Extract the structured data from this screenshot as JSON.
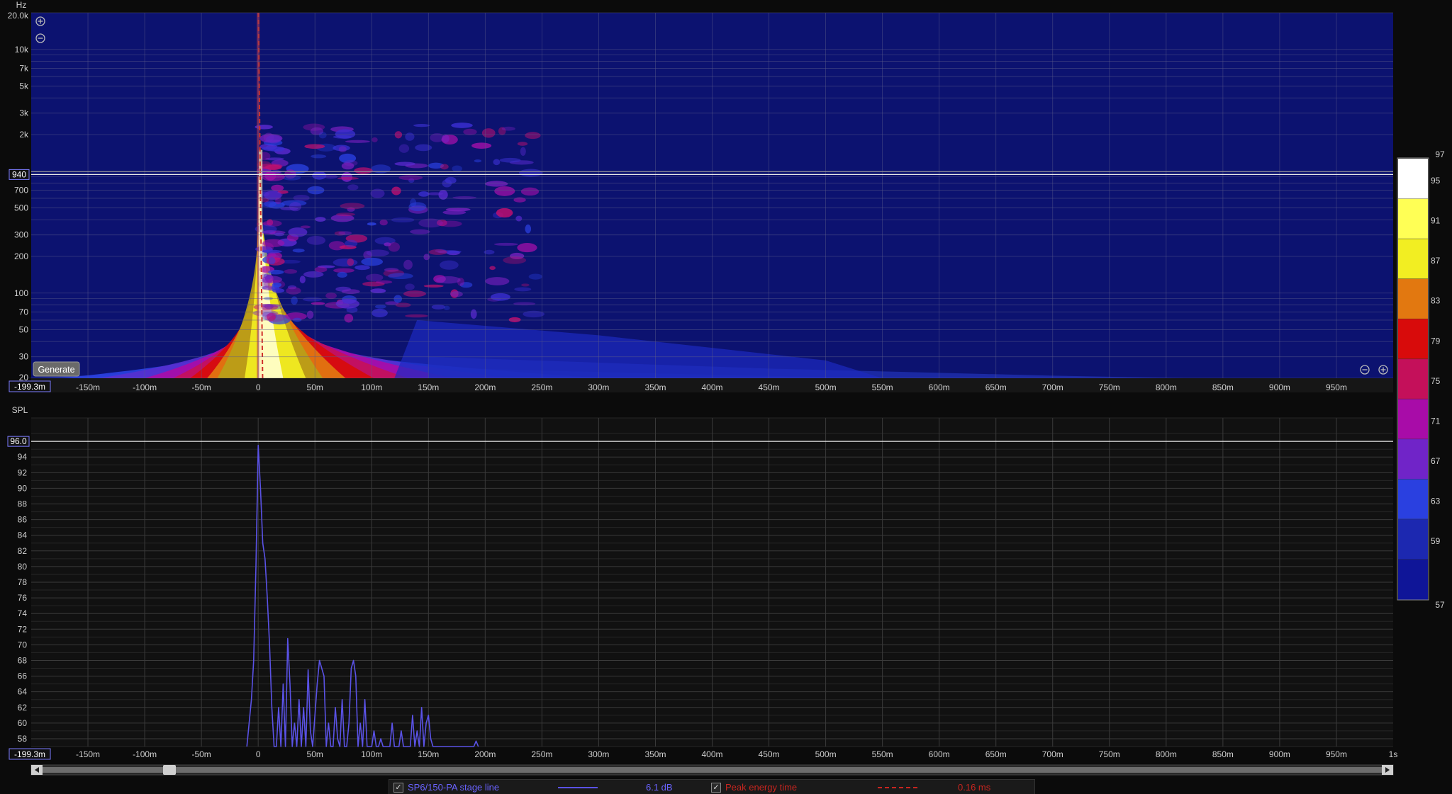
{
  "colors": {
    "bg": "#0b0b0b",
    "panel": "#111111",
    "spectro_bg": "#0c1270",
    "grid": "#3a3a3a",
    "trace": "#5a52e6",
    "peak_line": "#d0302a",
    "cursor": "#e8e8e8",
    "label_box_border": "#7b7bff"
  },
  "spectrogram": {
    "unit_label": "Hz",
    "y_ticks": [
      {
        "v": 20000,
        "label": "20.0k"
      },
      {
        "v": 10000,
        "label": "10k"
      },
      {
        "v": 7000,
        "label": "7k"
      },
      {
        "v": 5000,
        "label": "5k"
      },
      {
        "v": 3000,
        "label": "3k"
      },
      {
        "v": 2000,
        "label": "2k"
      },
      {
        "v": 700,
        "label": "700"
      },
      {
        "v": 500,
        "label": "500"
      },
      {
        "v": 300,
        "label": "300"
      },
      {
        "v": 200,
        "label": "200"
      },
      {
        "v": 100,
        "label": "100"
      },
      {
        "v": 70,
        "label": "70"
      },
      {
        "v": 50,
        "label": "50"
      },
      {
        "v": 30,
        "label": "30"
      },
      {
        "v": 20,
        "label": "20"
      }
    ],
    "cursor_freq": 940,
    "cursor_label": "940",
    "x_cursor_label": "-199.3m",
    "generate_button": "Generate"
  },
  "colorbar": {
    "top_label": "97",
    "bottom_label": "57",
    "ticks": [
      "95",
      "91",
      "87",
      "83",
      "79",
      "75",
      "71",
      "67",
      "63",
      "59"
    ],
    "bands": [
      "#ffffff",
      "#ffff55",
      "#f2ee22",
      "#e27810",
      "#d80b0b",
      "#c4105a",
      "#a80ca8",
      "#7024c8",
      "#2a40e0",
      "#1c28b0",
      "#0f1598"
    ]
  },
  "x_axis": {
    "min": -0.2,
    "max": 1.0,
    "ticks": [
      {
        "v": -0.15,
        "label": "-150m"
      },
      {
        "v": -0.1,
        "label": "-100m"
      },
      {
        "v": -0.05,
        "label": "-50m"
      },
      {
        "v": 0,
        "label": "0"
      },
      {
        "v": 0.05,
        "label": "50m"
      },
      {
        "v": 0.1,
        "label": "100m"
      },
      {
        "v": 0.15,
        "label": "150m"
      },
      {
        "v": 0.2,
        "label": "200m"
      },
      {
        "v": 0.25,
        "label": "250m"
      },
      {
        "v": 0.3,
        "label": "300m"
      },
      {
        "v": 0.35,
        "label": "350m"
      },
      {
        "v": 0.4,
        "label": "400m"
      },
      {
        "v": 0.45,
        "label": "450m"
      },
      {
        "v": 0.5,
        "label": "500m"
      },
      {
        "v": 0.55,
        "label": "550m"
      },
      {
        "v": 0.6,
        "label": "600m"
      },
      {
        "v": 0.65,
        "label": "650m"
      },
      {
        "v": 0.7,
        "label": "700m"
      },
      {
        "v": 0.75,
        "label": "750m"
      },
      {
        "v": 0.8,
        "label": "800m"
      },
      {
        "v": 0.85,
        "label": "850m"
      },
      {
        "v": 0.9,
        "label": "900m"
      },
      {
        "v": 0.95,
        "label": "950m"
      }
    ],
    "end_label_bottom": "1s"
  },
  "spl": {
    "label": "SPL",
    "cursor_label": "96.0",
    "x_cursor_label": "-199.3m",
    "ylim": [
      57,
      99
    ]
  },
  "legend": {
    "series1_name": "SP6/150-PA stage line",
    "series1_value": "6.1 dB",
    "series2_name": "Peak energy time",
    "series2_value": "0.16 ms"
  },
  "chart_data": [
    {
      "type": "heatmap",
      "title": "",
      "xlabel": "",
      "ylabel": "Hz",
      "x_range": [
        -0.2,
        1.0
      ],
      "y_range": [
        20,
        20000
      ],
      "y_scale": "log",
      "z_range": [
        57,
        97
      ],
      "peak_energy_time_ms": 0.16,
      "cursor": {
        "freq_hz": 940,
        "time": -0.1993
      }
    },
    {
      "type": "line",
      "title": "",
      "xlabel": "",
      "ylabel": "SPL",
      "xlim": [
        -0.2,
        1.0
      ],
      "ylim": [
        57,
        99
      ],
      "y_ticks": [
        58,
        60,
        62,
        64,
        66,
        68,
        70,
        72,
        74,
        76,
        78,
        80,
        82,
        84,
        86,
        88,
        90,
        92,
        94
      ],
      "series": [
        {
          "name": "SP6/150-PA stage line",
          "x": [
            -0.01,
            -0.006,
            -0.004,
            -0.002,
            0.0,
            0.002,
            0.004,
            0.006,
            0.008,
            0.01,
            0.012,
            0.014,
            0.016,
            0.018,
            0.02,
            0.022,
            0.024,
            0.026,
            0.028,
            0.03,
            0.032,
            0.034,
            0.036,
            0.038,
            0.04,
            0.042,
            0.044,
            0.046,
            0.048,
            0.05,
            0.052,
            0.054,
            0.056,
            0.058,
            0.06,
            0.062,
            0.064,
            0.066,
            0.068,
            0.07,
            0.072,
            0.074,
            0.076,
            0.078,
            0.08,
            0.082,
            0.084,
            0.086,
            0.088,
            0.09,
            0.092,
            0.094,
            0.096,
            0.098,
            0.1,
            0.102,
            0.104,
            0.106,
            0.108,
            0.11,
            0.112,
            0.114,
            0.116,
            0.118,
            0.12,
            0.122,
            0.124,
            0.126,
            0.128,
            0.13,
            0.132,
            0.134,
            0.136,
            0.138,
            0.14,
            0.142,
            0.144,
            0.146,
            0.148,
            0.15,
            0.152,
            0.154,
            0.156,
            0.19,
            0.192,
            0.194
          ],
          "values": [
            57,
            63,
            68,
            80,
            95.5,
            90,
            83,
            81,
            76,
            70,
            62,
            57,
            57,
            62,
            57,
            65,
            57,
            70.8,
            65,
            57,
            60,
            57,
            63,
            57,
            62,
            57,
            66.8,
            59,
            57,
            61,
            65,
            68,
            67,
            66,
            57,
            60,
            57,
            57,
            62,
            58,
            57,
            63,
            57,
            57,
            60,
            67,
            68,
            66,
            57,
            60,
            57,
            63,
            57,
            57,
            57,
            59,
            57,
            57,
            58,
            57,
            57,
            57,
            57,
            60,
            57,
            57,
            57,
            59,
            57,
            57,
            57,
            57,
            61,
            57,
            59,
            57,
            62,
            57,
            60,
            61,
            58,
            57,
            57,
            57,
            57.7,
            57
          ]
        }
      ],
      "cursor": {
        "spl": 96.0,
        "time": -0.1993
      }
    }
  ]
}
